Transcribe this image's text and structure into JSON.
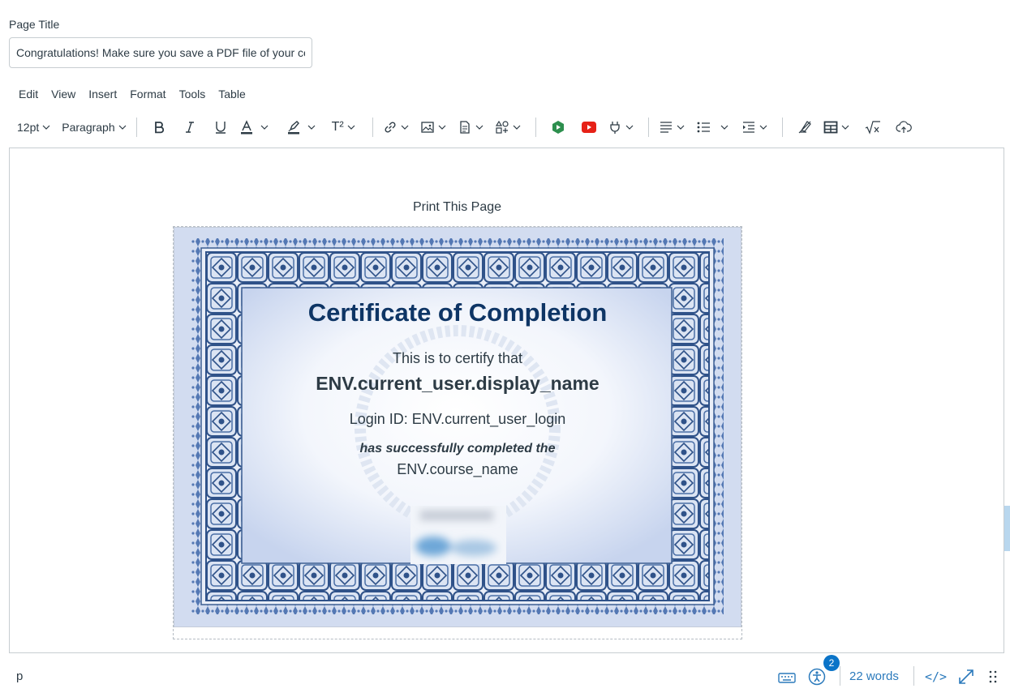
{
  "page_title": {
    "label": "Page Title",
    "value": "Congratulations! Make sure you save a PDF file of your certificate"
  },
  "menubar": [
    "Edit",
    "View",
    "Insert",
    "Format",
    "Tools",
    "Table"
  ],
  "toolbar": {
    "font_size": "12pt",
    "block_format": "Paragraph",
    "superscript_label": "T²",
    "icons": [
      "bold-icon",
      "italic-icon",
      "underline-icon",
      "text-color-icon",
      "highlight-icon",
      "superscript-icon",
      "link-icon",
      "image-icon",
      "document-icon",
      "apps-icon",
      "media-plugin-icon",
      "youtube-icon",
      "plugin-icon",
      "align-icon",
      "bullet-list-icon",
      "indent-icon",
      "clear-format-icon",
      "table-icon",
      "equation-icon",
      "cloud-upload-icon"
    ]
  },
  "editor": {
    "print_link": "Print This Page",
    "certificate": {
      "title": "Certificate of Completion",
      "certify": "This is to certify that",
      "name": "ENV.current_user.display_name",
      "login": "Login ID: ENV.current_user_login",
      "completed": "has successfully completed the",
      "course": "ENV.course_name"
    }
  },
  "statusbar": {
    "path": "p",
    "a11y_badge": "2",
    "word_count": "22 words",
    "html_toggle": "</>"
  },
  "colors": {
    "accent": "#2b7abc",
    "badge": "#0b74c8",
    "cert_title": "#0e3565",
    "cert_border": "#3c5e92"
  }
}
